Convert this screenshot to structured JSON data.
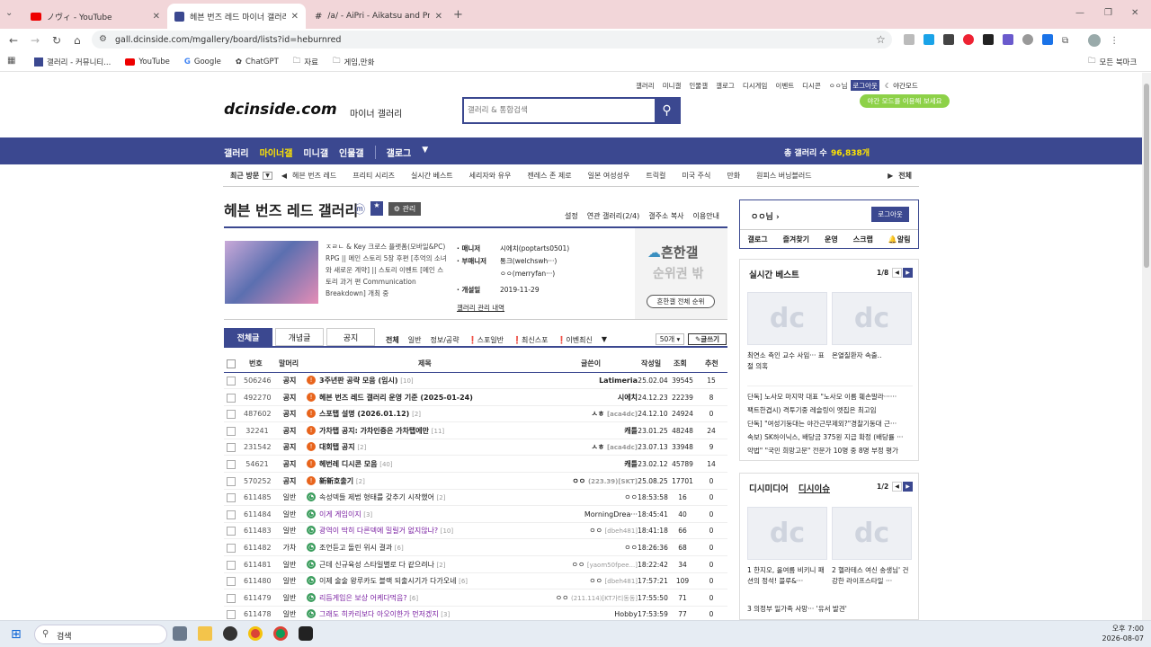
{
  "browser": {
    "tabs": [
      {
        "title": "ノヴィ - YouTube",
        "icon": "youtube-icon"
      },
      {
        "title": "헤븐 번즈 레드 마이너 갤러리",
        "icon": "dc-icon",
        "active": true
      },
      {
        "title": "/a/ - AiPri - Aikatsu and Prett",
        "icon": "site-icon"
      }
    ],
    "new_tab": "+",
    "url": "gall.dcinside.com/mgallery/board/lists?id=heburnred",
    "bookmarks": [
      "갤러리 - 커뮤니티...",
      "YouTube",
      "Google",
      "ChatGPT",
      "자료",
      "게임,만화"
    ],
    "all_bookmarks": "모든 북마크"
  },
  "site": {
    "toplinks": [
      "갤러리",
      "미니갤",
      "인물갤",
      "갤로그",
      "디시게임",
      "이벤트",
      "디시콘"
    ],
    "user": "ㅇㅇ님",
    "logout": "로그아웃",
    "dark_mode": "야간모드",
    "dark_tip": "야간 모드를 이용해 보세요",
    "logo": "dcinside.com",
    "logo_sub": "마이너 갤러리",
    "search_placeholder": "갤러리 & 통합검색",
    "nav": [
      "갤러리",
      "마이너갤",
      "미니갤",
      "인물갤",
      "갤로그"
    ],
    "total_label": "총 갤러리 수",
    "total_count": "96,838개",
    "recent_label": "최근 방문",
    "recent": [
      "헤븐 번즈 레드",
      "프리티 시리즈",
      "실시간 베스트",
      "세리자와 유우",
      "젠레스 존 제로",
      "일본 여성성우",
      "트릭컬",
      "미국 주식",
      "만화",
      "원피스 버닝블러드"
    ],
    "recent_all": "전체"
  },
  "gallery": {
    "title": "헤븐 번즈 레드 갤러리",
    "m_badge": "ⓜ",
    "manage": "관리",
    "links": [
      "설정",
      "연관 갤러리(2/4)",
      "갤주소 복사",
      "이용안내"
    ],
    "desc": "ㅈㄹㄴ & Key 크로스 플랫폼(모바일&PC) RPG || 메인 스토리 5장 후편 [추억의 소녀와 새로운 계약] || 스토리 이벤트 [메인 스토리 과거 편 Communication Breakdown] 개최 중",
    "info": [
      {
        "k": "매니저",
        "v": "시에치(poptarts0501)"
      },
      {
        "k": "부매니저",
        "v": "통크(welchswh···)"
      },
      {
        "k": "",
        "v": "ㅇㅇ(merryfan···)"
      },
      {
        "k": "개설일",
        "v": "2019-11-29"
      }
    ],
    "history": "갤러리 관리 내역",
    "rank_title": "흔한갤",
    "rank_sub": "순위권 밖",
    "rank_btn": "흔한갤 전체 순위",
    "tabs": [
      "전체글",
      "개념글",
      "공지"
    ],
    "filters": [
      "전체",
      "일반",
      "정보/공략",
      "스포일반",
      "최신스포",
      "이벤최신"
    ],
    "count_select": "50개",
    "write": "글쓰기",
    "columns": [
      "번호",
      "말머리",
      "제목",
      "글쓴이",
      "작성일",
      "조회",
      "추천"
    ],
    "posts": [
      {
        "no": "506246",
        "head": "공지",
        "title": "3주년판 공략 모음 (임시)",
        "cmt": "[10]",
        "writer": "Latimeria",
        "date": "25.02.04",
        "views": "39545",
        "rec": "15",
        "notice": true
      },
      {
        "no": "492270",
        "head": "공지",
        "title": "헤븐 번즈 레드 갤러리 운영 기준 (2025-01-24)",
        "cmt": "",
        "writer": "시에치",
        "date": "24.12.23",
        "views": "22239",
        "rec": "8",
        "notice": true
      },
      {
        "no": "487602",
        "head": "공지",
        "title": "스포탭 설명 (2026.01.12)",
        "cmt": "[2]",
        "writer": "ㅅㅎ",
        "ip": "[aca4dc]",
        "date": "24.12.10",
        "views": "24924",
        "rec": "0",
        "notice": true
      },
      {
        "no": "32241",
        "head": "공지",
        "title": "가차탭 공지: 가차인증은 가차탭에만",
        "cmt": "[11]",
        "writer": "캐틀",
        "date": "23.01.25",
        "views": "48248",
        "rec": "24",
        "notice": true
      },
      {
        "no": "231542",
        "head": "공지",
        "title": "대회탭 공지",
        "cmt": "[2]",
        "writer": "ㅅㅎ",
        "ip": "[aca4dc]",
        "date": "23.07.13",
        "views": "33948",
        "rec": "9",
        "notice": true
      },
      {
        "no": "54621",
        "head": "공지",
        "title": "헤번레 디시콘 모음",
        "cmt": "[40]",
        "writer": "캐틀",
        "date": "23.02.12",
        "views": "45789",
        "rec": "14",
        "notice": true
      },
      {
        "no": "570252",
        "head": "공지",
        "title": "新新호출기",
        "cmt": "[2]",
        "writer": "ㅇㅇ",
        "ip": "(223.39)[SKT]",
        "date": "25.08.25",
        "views": "17701",
        "rec": "0",
        "notice": true
      },
      {
        "no": "611485",
        "head": "일반",
        "title": "속성덱들 제법 형태를 갖추기 시작했어",
        "cmt": "[2]",
        "writer": "ㅇㅇ",
        "date": "18:53:58",
        "views": "16",
        "rec": "0"
      },
      {
        "no": "611484",
        "head": "일반",
        "title": "이게 게임이지",
        "cmt": "[3]",
        "writer": "MorningDrea···",
        "date": "18:45:41",
        "views": "40",
        "rec": "0",
        "visited": true
      },
      {
        "no": "611483",
        "head": "일반",
        "title": "광역이 딱히 다른덱에 밀릴거 없지않나?",
        "cmt": "[10]",
        "writer": "ㅇㅇ",
        "ip": "[dbeh481]",
        "date": "18:41:18",
        "views": "66",
        "rec": "0",
        "visited": true
      },
      {
        "no": "611482",
        "head": "가차",
        "title": "조언듣고 돌린 위시 결과",
        "cmt": "[6]",
        "writer": "ㅇㅇ",
        "date": "18:26:36",
        "views": "68",
        "rec": "0"
      },
      {
        "no": "611481",
        "head": "일반",
        "title": "근데 신규육성 스타일별로 다 같으려나",
        "cmt": "[2]",
        "writer": "ㅇㅇ",
        "ip": "[yaom50fpee...]",
        "date": "18:22:42",
        "views": "34",
        "rec": "0"
      },
      {
        "no": "611480",
        "head": "일반",
        "title": "이제 술술 왕루카도 블랙 되출시기가 다가오네",
        "cmt": "[6]",
        "writer": "ㅇㅇ",
        "ip": "[dbeh481]",
        "date": "17:57:21",
        "views": "109",
        "rec": "0"
      },
      {
        "no": "611479",
        "head": "일반",
        "title": "리듬게임은 보상 어케다먹음?",
        "cmt": "[6]",
        "writer": "ㅇㅇ",
        "ip": "(211.114)[KT가티동동]",
        "date": "17:55:50",
        "views": "71",
        "rec": "0",
        "visited": true
      },
      {
        "no": "611478",
        "head": "일반",
        "title": "그래도 히카리보다 아오이한가 먼저겠지",
        "cmt": "[3]",
        "writer": "Hobby",
        "date": "17:53:59",
        "views": "77",
        "rec": "0",
        "visited": true
      }
    ]
  },
  "sidebar": {
    "user": "ㅇㅇ님",
    "logout": "로그아웃",
    "menu": [
      "갤로그",
      "즐겨찾기",
      "운영",
      "스크랩",
      "알림"
    ],
    "best_title": "실시간 베스트",
    "best_page": "1/8",
    "best_captions": [
      "최연소 측인 교수 사임··· 표절 의혹",
      "온열질환자 속출.."
    ],
    "news": [
      "단독] 노사모 마지막 대표 \"노사모 이름 훼손말라······",
      "팩트한겹시) 격투기중 레슬링이 멧집은 최고임",
      "단독] \"여성기둥대는 야간근무제외?\"경찰기동대 근···",
      "속보) SK하이닉스, 배당금 375원 지급 확정 (배당률 ···",
      "악법\" \"국민 희망고문\" 전문가 10명 중 8명 부정 평가"
    ],
    "dc_title": "디시미디어",
    "dc_title2": "디시이슈",
    "dc_page": "1/2",
    "dc_captions": [
      "1 한지오, 올여름 비키니 패션의 정석! 블루&···",
      "2 헬라테스 여신 송생님' 건강한 라이프스타일 ···"
    ],
    "dc_item3": "3 의정부 일가족 사망··· '유서 발견'"
  },
  "taskbar": {
    "search": "검색",
    "time": "오후 7:00",
    "date": "2026-08-07"
  },
  "colors": {
    "nav": "#3b4890",
    "accent": "#ffe500",
    "tab_bg": "#f2d6d9"
  }
}
